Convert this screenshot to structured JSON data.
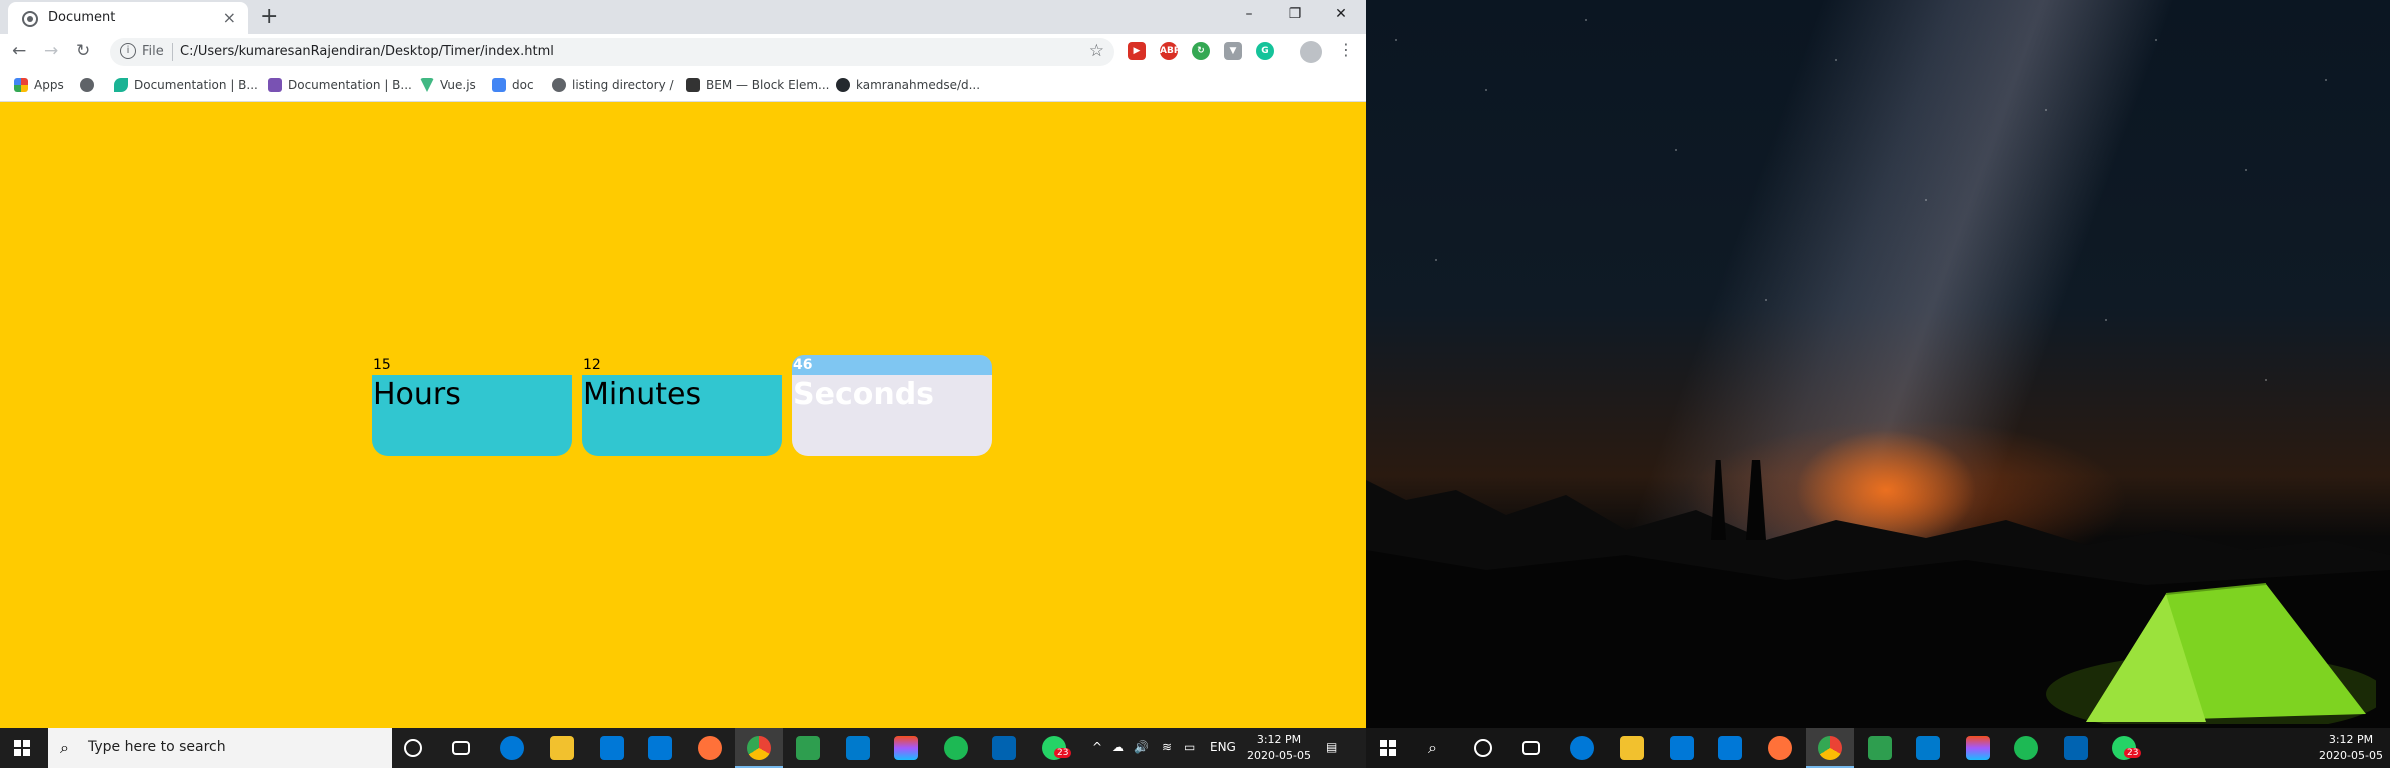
{
  "browser": {
    "tab_title": "Document",
    "url_scheme": "File",
    "url": "C:/Users/kumaresanRajendiran/Desktop/Timer/index.html",
    "bookmarks": [
      {
        "label": "Apps",
        "icon": "apps-grid-icon",
        "color": "#ea4335"
      },
      {
        "label": "",
        "icon": "globe-icon",
        "color": "#5f6368"
      },
      {
        "label": "Documentation | B...",
        "icon": "leaf-icon",
        "color": "#1ab394"
      },
      {
        "label": "Documentation | B...",
        "icon": "bootstrap-icon",
        "color": "#7952b3"
      },
      {
        "label": "Vue.js",
        "icon": "vue-icon",
        "color": "#41b883"
      },
      {
        "label": "doc",
        "icon": "doc-icon",
        "color": "#4285f4"
      },
      {
        "label": "listing directory /",
        "icon": "globe-icon",
        "color": "#5f6368"
      },
      {
        "label": "BEM — Block Elem...",
        "icon": "bem-icon",
        "color": "#333333"
      },
      {
        "label": "kamranahmedse/d...",
        "icon": "github-icon",
        "color": "#24292e"
      }
    ]
  },
  "timer": [
    {
      "value": "15",
      "label": "Hours"
    },
    {
      "value": "12",
      "label": "Minutes"
    },
    {
      "value": "46",
      "label": "Seconds"
    }
  ],
  "taskbar": {
    "search_placeholder": "Type here to search",
    "lang": "ENG",
    "time": "3:12 PM",
    "date": "2020-05-05",
    "whatsapp_badge": "23"
  },
  "right_taskbar": {
    "time": "3:12 PM",
    "date": "2020-05-05",
    "whatsapp_badge": "23"
  },
  "colors": {
    "page_bg": "#ffcb00",
    "card": "#31c6d0",
    "active_card": "#e8e6ef",
    "active_header": "#7fc6f2"
  }
}
